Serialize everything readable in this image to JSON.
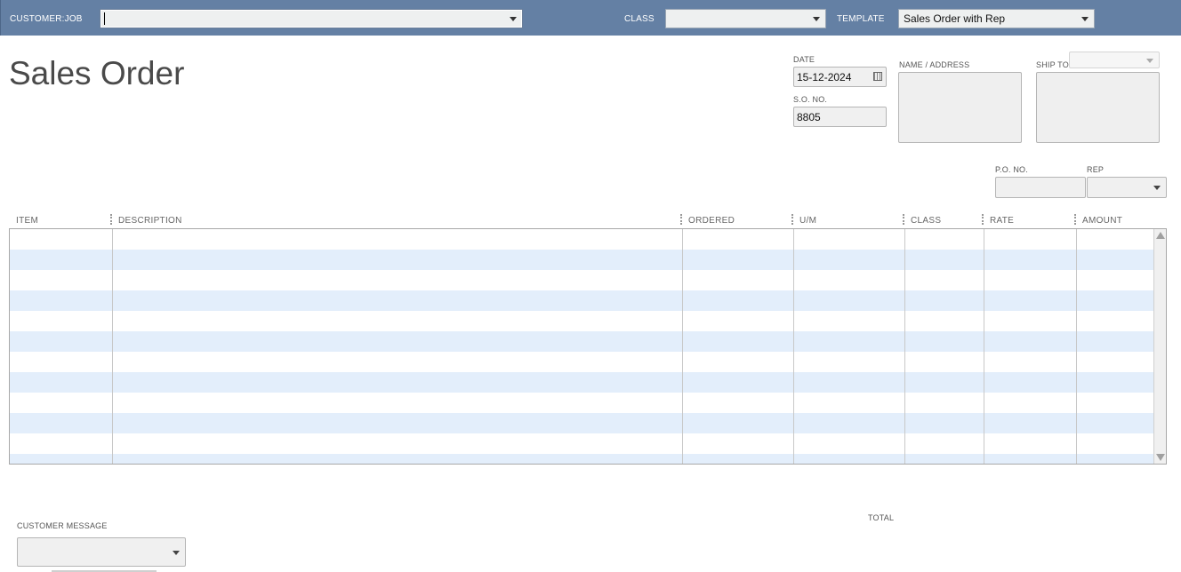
{
  "topbar": {
    "customer_job_label": "CUSTOMER:JOB",
    "customer_job_value": "",
    "class_label": "CLASS",
    "class_value": "",
    "template_label": "TEMPLATE",
    "template_value": "Sales Order with Rep"
  },
  "form": {
    "title": "Sales Order",
    "date_label": "DATE",
    "date_value": "15-12-2024",
    "so_no_label": "S.O. NO.",
    "so_no_value": "8805",
    "name_address_label": "NAME / ADDRESS",
    "ship_to_label": "SHIP TO",
    "po_no_label": "P.O. NO.",
    "rep_label": "REP"
  },
  "grid": {
    "columns": [
      "ITEM",
      "DESCRIPTION",
      "ORDERED",
      "U/M",
      "CLASS",
      "RATE",
      "AMOUNT"
    ],
    "row_count": 12
  },
  "footer": {
    "customer_message_label": "CUSTOMER MESSAGE",
    "total_label": "TOTAL"
  },
  "colors": {
    "topbar": "#6480a4",
    "row_alt": "#e3eefb"
  }
}
